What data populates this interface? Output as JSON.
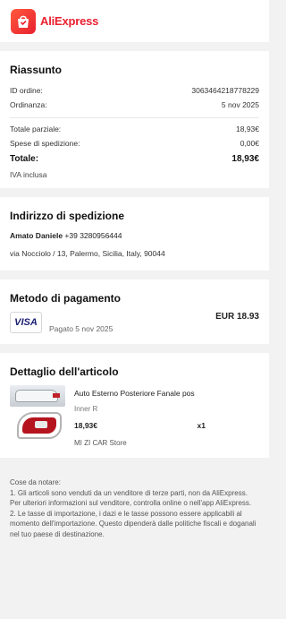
{
  "header": {
    "brand": "AliExpress"
  },
  "summary": {
    "title": "Riassunto",
    "order_id_label": "ID ordine:",
    "order_id": "3063464218778229",
    "ordered_label": "Ordinanza:",
    "ordered_date": "5 nov 2025",
    "subtotal_label": "Totale parziale:",
    "subtotal": "18,93€",
    "shipping_label": "Spese di spedizione:",
    "shipping": "0,00€",
    "total_label": "Totale:",
    "total": "18,93€",
    "vat_note": "IVA inclusa"
  },
  "shipping_address": {
    "title": "Indirizzo di spedizione",
    "name": "Amato Daniele",
    "phone": "+39 3280956444",
    "address": "via Nocciolo / 13, Palermo, Sicilia, Italy, 90044"
  },
  "payment": {
    "title": "Metodo di pagamento",
    "card_brand": "VISA",
    "paid_text": "Pagato 5 nov 2025",
    "amount": "EUR 18.93"
  },
  "item_detail": {
    "title": "Dettaglio dell'articolo",
    "item": {
      "name": "Auto Esterno Posteriore Fanale pos",
      "variant": "Inner R",
      "price": "18,93€",
      "quantity": "x1",
      "store": "MI ZI CAR Store"
    }
  },
  "notes": {
    "heading": "Cose da notare:",
    "note1": "1. Gli articoli sono venduti da un venditore di terze parti, non da AliExpress. Per ulteriori informazioni sul venditore, controlla online o nell'app AliExpress.",
    "note2": "2. Le tasse di importazione, i dazi e le tasse possono essere applicabili al momento dell'importazione. Questo dipenderà dalle politiche fiscali e doganali nel tuo paese di destinazione."
  },
  "colors": {
    "brand": "#e8202f",
    "visa": "#1a1f71"
  },
  "icons": {
    "logo": "shopping-bag-icon",
    "card": "visa-icon"
  }
}
